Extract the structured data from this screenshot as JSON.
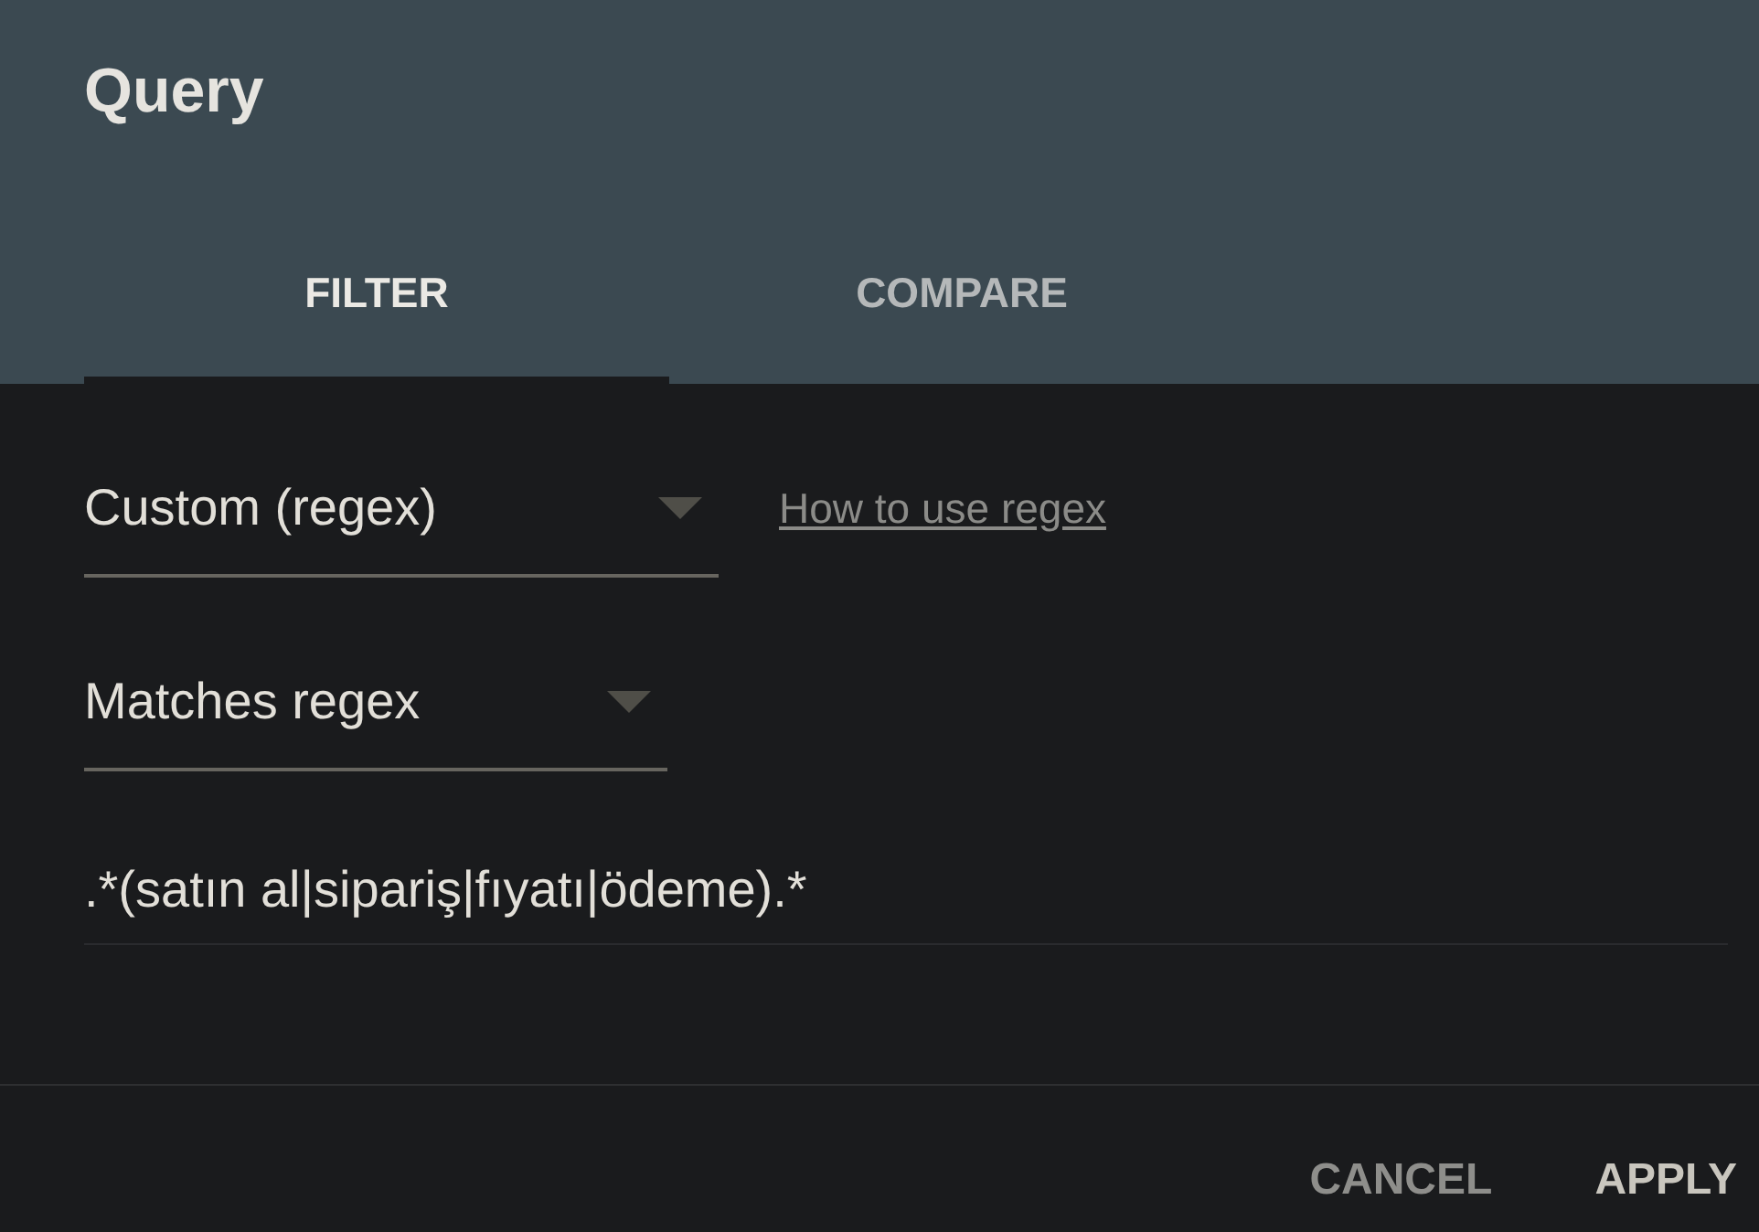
{
  "dialog": {
    "title": "Query"
  },
  "tabs": [
    {
      "label": "FILTER",
      "selected": true
    },
    {
      "label": "COMPARE",
      "selected": false
    }
  ],
  "filter": {
    "match_type": {
      "value": "Custom (regex)"
    },
    "help_link": "How to use regex",
    "condition": {
      "value": "Matches regex"
    },
    "pattern": {
      "value": ".*(satın al|sipariş|fıyatı|ödeme).*"
    }
  },
  "buttons": [
    {
      "label": "CANCEL",
      "kind": "secondary"
    },
    {
      "label": "APPLY",
      "kind": "primary"
    }
  ]
}
